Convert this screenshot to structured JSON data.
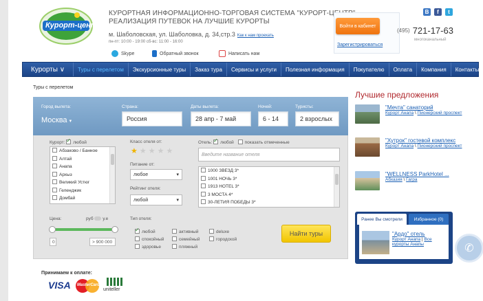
{
  "header": {
    "logo_text": "Курорт-центр",
    "brand_line1": "КУРОРТНАЯ ИНФОРМАЦИОННО-ТОРГОВАЯ СИСТЕМА \"КУРОРТ-ЦЕНТР\"",
    "brand_line2": "РЕАЛИЗАЦИЯ ПУТЕВОК НА ЛУЧШИЕ КУРОРТЫ",
    "address": "м. Шаболовская, ул. Шаболовка, д. 34,стр.3",
    "route_link": "Как к нам проехать",
    "hours": "пн-пт: 10:00 - 19:00   сб-вс: 11:00 - 16:00",
    "contacts": [
      {
        "label": "Skype",
        "icon": "skype-icon"
      },
      {
        "label": "Обратный звонок",
        "icon": "mobile-phone-icon"
      },
      {
        "label": "Написать нам",
        "icon": "mail-icon"
      }
    ],
    "cabinet_button": "Войти в кабинет",
    "register_link": "Зарегистрироваться",
    "phone_code": "(495)",
    "phone_number": "721-17-63",
    "phone_note": "многоканальный",
    "social": [
      "B",
      "f",
      "t"
    ]
  },
  "nav": {
    "items": [
      "Курорты ∨",
      "Туры с перелетом",
      "Экскурсионные туры",
      "Заказ тура",
      "Сервисы и услуги",
      "Полезная информация",
      "Покупателю",
      "Оплата",
      "Компания",
      "Контакты"
    ],
    "active_index": 1
  },
  "breadcrumb": "Туры с перелетом",
  "search": {
    "departure_label": "Город вылета:",
    "departure_value": "Москва",
    "country_label": "Страна:",
    "country_value": "Россия",
    "dates_label": "Даты вылета:",
    "dates_value": "28 апр - 7 май",
    "nights_label": "Ночей:",
    "nights_value": "6 - 14",
    "tourists_label": "Туристы:",
    "tourists_value": "2 взрослых",
    "resort_label": "Курорт:",
    "any_label": "любой",
    "resorts": [
      "Абзаково / Банное",
      "Алтай",
      "Анапа",
      "Архыз",
      "Великий Устюг",
      "Геленджик",
      "Домбай"
    ],
    "hotel_class_label": "Класс отеля от:",
    "stars_filled": 1,
    "meal_label": "Питание от:",
    "meal_value": "любое",
    "rating_label": "Рейтинг отеля:",
    "rating_value": "любой",
    "hotel_label": "Отель:",
    "show_marked": "показать отмеченные",
    "hotel_placeholder": "Введите название отеля",
    "hotels": [
      "1000 ЗВЕЗД 3*",
      "1001 НОЧЬ 3*",
      "1913 HOTEL 3*",
      "3 МОСТА 4*",
      "30-ЛЕТИЯ ПОБЕДЫ 3*"
    ],
    "price_label": "Цена:",
    "currency_rub": "руб",
    "currency_eur": "у.е",
    "price_from": "0",
    "price_to": "> 900 000",
    "hotel_type_label": "Тип отеля:",
    "hotel_types": [
      {
        "label": "любой",
        "checked": true
      },
      {
        "label": "активный",
        "checked": false
      },
      {
        "label": "deluxe",
        "checked": false
      },
      {
        "label": "спокойный",
        "checked": false
      },
      {
        "label": "семейный",
        "checked": false
      },
      {
        "label": "городской",
        "checked": false
      },
      {
        "label": "здоровье",
        "checked": false
      },
      {
        "label": "пляжный",
        "checked": false
      }
    ],
    "find_button": "Найти туры"
  },
  "best": {
    "title": "Лучшие предложения",
    "offers": [
      {
        "title": "\"Мечта\" санаторий",
        "meta1": "Курорт Анапа",
        "meta2": "Пионерский проспект"
      },
      {
        "title": "\"Хутрок\" гостевой комплекс",
        "meta1": "Курорт Анапа",
        "meta2": "Пионерский проспект"
      },
      {
        "title": "\"WELLNESS ParkHotel ...",
        "meta1": "Абхазия",
        "meta2": "Гагра"
      }
    ]
  },
  "viewed": {
    "tab_recent": "Ранее Вы смотрели",
    "tab_fav": "Избранное (0)",
    "item_title": "\"Ардо\" отель",
    "item_meta1": "Курорт Анапа",
    "item_meta2": "Все курорты Анапы"
  },
  "payment": {
    "label": "Принимаем к оплате:",
    "visa": "VISA",
    "mastercard": "MasterCard",
    "uniteller": "uniteller"
  },
  "colors": {
    "nav": "#1c4486",
    "accent_orange": "#ef7410",
    "find_yellow": "#f1c500",
    "title_red": "#b0282d"
  }
}
